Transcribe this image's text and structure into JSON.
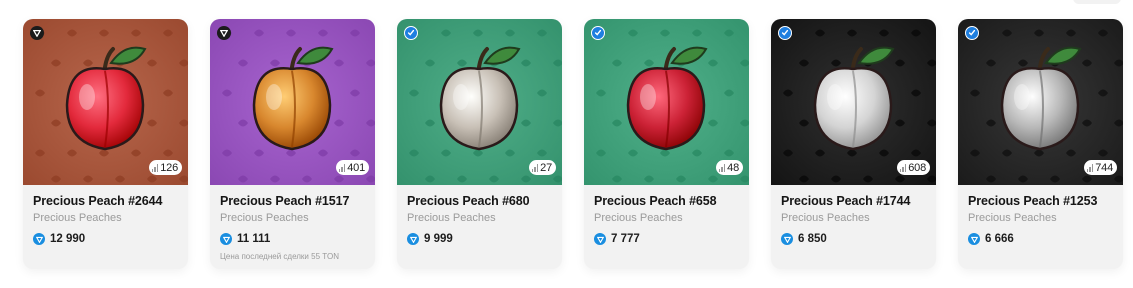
{
  "cards": [
    {
      "name": "Precious Peach #2644",
      "collection": "Precious Peaches",
      "price": "12 990",
      "count": "126",
      "badge": "dark",
      "last_sale": "",
      "bg": "#a5543a",
      "peach": "#e32a3c"
    },
    {
      "name": "Precious Peach #1517",
      "collection": "Precious Peaches",
      "price": "11 111",
      "count": "401",
      "badge": "dark",
      "last_sale": "Цена последней сделки 55 TON",
      "bg": "#9552bd",
      "peach": "#d8872e"
    },
    {
      "name": "Precious Peach #680",
      "collection": "Precious Peaches",
      "price": "9 999",
      "count": "27",
      "badge": "blue",
      "last_sale": "",
      "bg": "#3e9c77",
      "peach": "#c8c0b6"
    },
    {
      "name": "Precious Peach #658",
      "collection": "Precious Peaches",
      "price": "7 777",
      "count": "48",
      "badge": "blue",
      "last_sale": "",
      "bg": "#3e9e78",
      "peach": "#cc2236"
    },
    {
      "name": "Precious Peach #1744",
      "collection": "Precious Peaches",
      "price": "6 850",
      "count": "608",
      "badge": "blue",
      "last_sale": "",
      "bg": "#1e1e1e",
      "peach": "#d4d4d4"
    },
    {
      "name": "Precious Peach #1253",
      "collection": "Precious Peaches",
      "price": "6 666",
      "count": "744",
      "badge": "blue",
      "last_sale": "",
      "bg": "#252525",
      "peach": "#b8b8b8"
    }
  ]
}
